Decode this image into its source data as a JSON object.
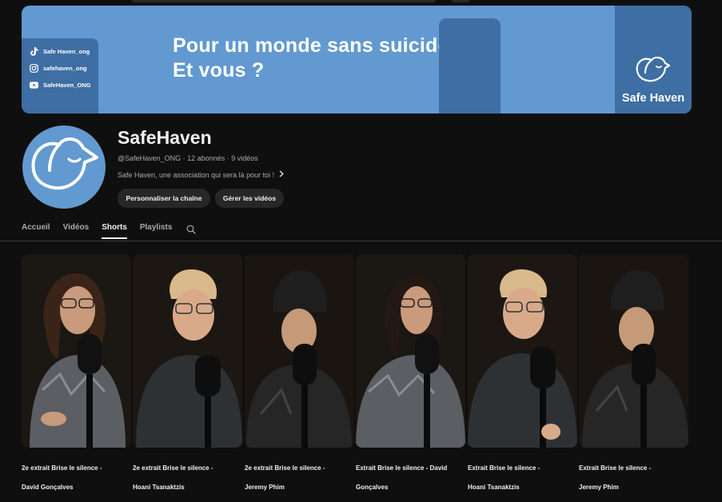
{
  "banner": {
    "headline_line1": "Pour un monde sans suicide,",
    "headline_line2": "Et vous ?",
    "socials": [
      {
        "icon": "tiktok-icon",
        "label": "Safe Haven_ong"
      },
      {
        "icon": "instagram-icon",
        "label": "safehaven_ong"
      },
      {
        "icon": "youtube-icon",
        "label": "SafeHaven_ONG"
      }
    ],
    "logo_text": "Safe Haven",
    "colors": {
      "light": "#6299d0",
      "dark": "#3e6ea3"
    }
  },
  "channel": {
    "name": "SafeHaven",
    "handle": "@SafeHaven_ONG",
    "subscribers": "12 abonnés",
    "videos": "9 vidéos",
    "separator": " · ",
    "description": "Safe Haven, une association qui sera là pour toi !",
    "buttons": {
      "customize": "Personnaliser la chaîne",
      "manage": "Gérer les vidéos"
    }
  },
  "tabs": [
    {
      "label": "Accueil",
      "active": false
    },
    {
      "label": "Vidéos",
      "active": false
    },
    {
      "label": "Shorts",
      "active": true
    },
    {
      "label": "Playlists",
      "active": false
    }
  ],
  "shorts": [
    {
      "title_line1": "2e extrait Brise le silence -",
      "title_line2": "David Gonçalves",
      "person": "david"
    },
    {
      "title_line1": "2e extrait Brise le silence -",
      "title_line2": "Hoani Tsanaktzis",
      "person": "hoani"
    },
    {
      "title_line1": "2e extrait Brise le silence -",
      "title_line2": "Jeremy Phim",
      "person": "jeremy"
    },
    {
      "title_line1": "Extrait Brise le silence - David",
      "title_line2": "Gonçalves",
      "person": "david"
    },
    {
      "title_line1": "Extrait Brise le silence -",
      "title_line2": "Hoani Tsanaktzis",
      "person": "hoani"
    },
    {
      "title_line1": "Extrait Brise le silence -",
      "title_line2": "Jeremy Phim",
      "person": "jeremy"
    }
  ]
}
